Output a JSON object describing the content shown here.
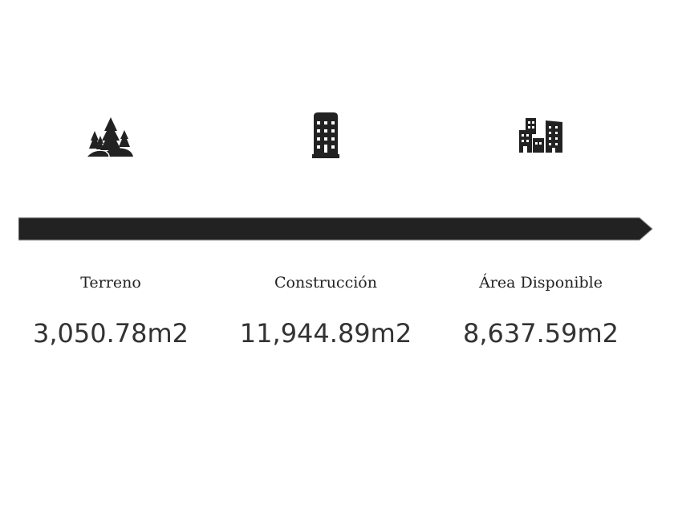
{
  "items": [
    {
      "icon": "trees-icon",
      "label": "Terreno",
      "value": "3,050.78m2"
    },
    {
      "icon": "building-icon",
      "label": "Construcción",
      "value": "11,944.89m2"
    },
    {
      "icon": "city-buildings-icon",
      "label": "Área Disponible",
      "value": "8,637.59m2"
    }
  ],
  "colors": {
    "arrow": "#222222",
    "icon": "#222222",
    "text": "#333333"
  }
}
